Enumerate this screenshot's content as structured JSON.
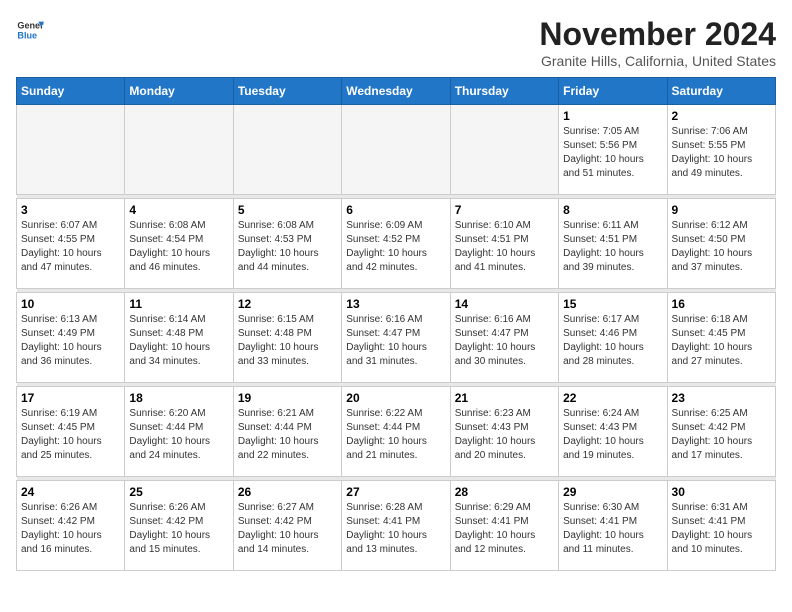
{
  "logo": {
    "line1": "General",
    "line2": "Blue"
  },
  "title": "November 2024",
  "location": "Granite Hills, California, United States",
  "weekdays": [
    "Sunday",
    "Monday",
    "Tuesday",
    "Wednesday",
    "Thursday",
    "Friday",
    "Saturday"
  ],
  "weeks": [
    [
      {
        "day": "",
        "info": ""
      },
      {
        "day": "",
        "info": ""
      },
      {
        "day": "",
        "info": ""
      },
      {
        "day": "",
        "info": ""
      },
      {
        "day": "",
        "info": ""
      },
      {
        "day": "1",
        "info": "Sunrise: 7:05 AM\nSunset: 5:56 PM\nDaylight: 10 hours\nand 51 minutes."
      },
      {
        "day": "2",
        "info": "Sunrise: 7:06 AM\nSunset: 5:55 PM\nDaylight: 10 hours\nand 49 minutes."
      }
    ],
    [
      {
        "day": "3",
        "info": "Sunrise: 6:07 AM\nSunset: 4:55 PM\nDaylight: 10 hours\nand 47 minutes."
      },
      {
        "day": "4",
        "info": "Sunrise: 6:08 AM\nSunset: 4:54 PM\nDaylight: 10 hours\nand 46 minutes."
      },
      {
        "day": "5",
        "info": "Sunrise: 6:08 AM\nSunset: 4:53 PM\nDaylight: 10 hours\nand 44 minutes."
      },
      {
        "day": "6",
        "info": "Sunrise: 6:09 AM\nSunset: 4:52 PM\nDaylight: 10 hours\nand 42 minutes."
      },
      {
        "day": "7",
        "info": "Sunrise: 6:10 AM\nSunset: 4:51 PM\nDaylight: 10 hours\nand 41 minutes."
      },
      {
        "day": "8",
        "info": "Sunrise: 6:11 AM\nSunset: 4:51 PM\nDaylight: 10 hours\nand 39 minutes."
      },
      {
        "day": "9",
        "info": "Sunrise: 6:12 AM\nSunset: 4:50 PM\nDaylight: 10 hours\nand 37 minutes."
      }
    ],
    [
      {
        "day": "10",
        "info": "Sunrise: 6:13 AM\nSunset: 4:49 PM\nDaylight: 10 hours\nand 36 minutes."
      },
      {
        "day": "11",
        "info": "Sunrise: 6:14 AM\nSunset: 4:48 PM\nDaylight: 10 hours\nand 34 minutes."
      },
      {
        "day": "12",
        "info": "Sunrise: 6:15 AM\nSunset: 4:48 PM\nDaylight: 10 hours\nand 33 minutes."
      },
      {
        "day": "13",
        "info": "Sunrise: 6:16 AM\nSunset: 4:47 PM\nDaylight: 10 hours\nand 31 minutes."
      },
      {
        "day": "14",
        "info": "Sunrise: 6:16 AM\nSunset: 4:47 PM\nDaylight: 10 hours\nand 30 minutes."
      },
      {
        "day": "15",
        "info": "Sunrise: 6:17 AM\nSunset: 4:46 PM\nDaylight: 10 hours\nand 28 minutes."
      },
      {
        "day": "16",
        "info": "Sunrise: 6:18 AM\nSunset: 4:45 PM\nDaylight: 10 hours\nand 27 minutes."
      }
    ],
    [
      {
        "day": "17",
        "info": "Sunrise: 6:19 AM\nSunset: 4:45 PM\nDaylight: 10 hours\nand 25 minutes."
      },
      {
        "day": "18",
        "info": "Sunrise: 6:20 AM\nSunset: 4:44 PM\nDaylight: 10 hours\nand 24 minutes."
      },
      {
        "day": "19",
        "info": "Sunrise: 6:21 AM\nSunset: 4:44 PM\nDaylight: 10 hours\nand 22 minutes."
      },
      {
        "day": "20",
        "info": "Sunrise: 6:22 AM\nSunset: 4:44 PM\nDaylight: 10 hours\nand 21 minutes."
      },
      {
        "day": "21",
        "info": "Sunrise: 6:23 AM\nSunset: 4:43 PM\nDaylight: 10 hours\nand 20 minutes."
      },
      {
        "day": "22",
        "info": "Sunrise: 6:24 AM\nSunset: 4:43 PM\nDaylight: 10 hours\nand 19 minutes."
      },
      {
        "day": "23",
        "info": "Sunrise: 6:25 AM\nSunset: 4:42 PM\nDaylight: 10 hours\nand 17 minutes."
      }
    ],
    [
      {
        "day": "24",
        "info": "Sunrise: 6:26 AM\nSunset: 4:42 PM\nDaylight: 10 hours\nand 16 minutes."
      },
      {
        "day": "25",
        "info": "Sunrise: 6:26 AM\nSunset: 4:42 PM\nDaylight: 10 hours\nand 15 minutes."
      },
      {
        "day": "26",
        "info": "Sunrise: 6:27 AM\nSunset: 4:42 PM\nDaylight: 10 hours\nand 14 minutes."
      },
      {
        "day": "27",
        "info": "Sunrise: 6:28 AM\nSunset: 4:41 PM\nDaylight: 10 hours\nand 13 minutes."
      },
      {
        "day": "28",
        "info": "Sunrise: 6:29 AM\nSunset: 4:41 PM\nDaylight: 10 hours\nand 12 minutes."
      },
      {
        "day": "29",
        "info": "Sunrise: 6:30 AM\nSunset: 4:41 PM\nDaylight: 10 hours\nand 11 minutes."
      },
      {
        "day": "30",
        "info": "Sunrise: 6:31 AM\nSunset: 4:41 PM\nDaylight: 10 hours\nand 10 minutes."
      }
    ]
  ]
}
